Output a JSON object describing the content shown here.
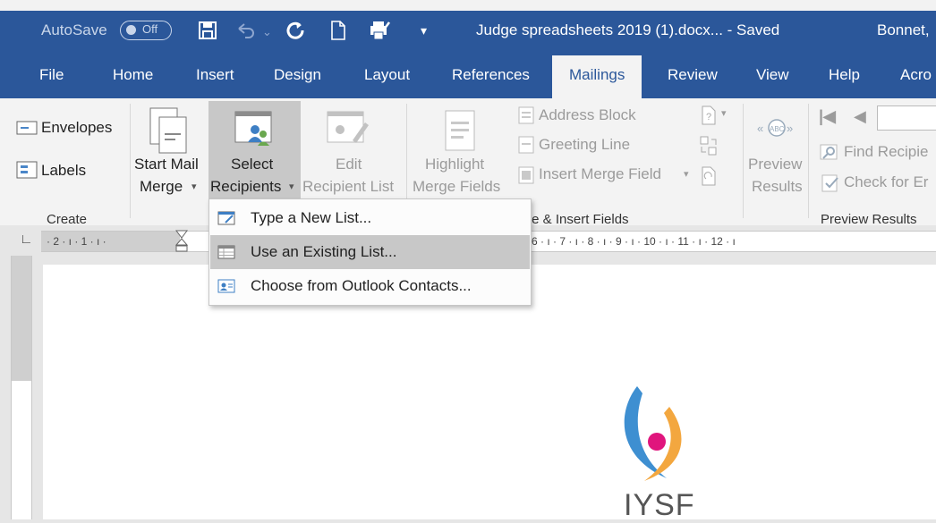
{
  "window": {
    "autosave_label": "AutoSave",
    "autosave_state": "Off",
    "document_title": "Judge spreadsheets 2019 (1).docx...  -  Saved",
    "user_name": "Bonnet,"
  },
  "tabs": [
    "File",
    "Home",
    "Insert",
    "Design",
    "Layout",
    "References",
    "Mailings",
    "Review",
    "View",
    "Help",
    "Acro"
  ],
  "active_tab": "Mailings",
  "ribbon": {
    "create": {
      "envelopes": "Envelopes",
      "labels": "Labels",
      "group": "Create"
    },
    "start_mail_merge": {
      "line1": "Start Mail",
      "line2": "Merge"
    },
    "select_recipients": {
      "line1": "Select",
      "line2": "Recipients"
    },
    "edit_recipient_list": {
      "line1": "Edit",
      "line2": "Recipient List"
    },
    "highlight_merge_fields": {
      "line1": "Highlight",
      "line2": "Merge Fields"
    },
    "address_block": "Address Block",
    "greeting_line": "Greeting Line",
    "insert_merge_field": "Insert Merge Field",
    "write_insert_group": "te & Insert Fields",
    "preview_results_btn": {
      "line1": "Preview",
      "line2": "Results"
    },
    "find_recipient": "Find Recipie",
    "check_for_errors": "Check for Er",
    "preview_group": "Preview Results"
  },
  "menu": {
    "items": [
      {
        "label": "Type a New List...",
        "highlighted": false
      },
      {
        "label": "Use an Existing List...",
        "highlighted": true
      },
      {
        "label": "Choose from Outlook Contacts...",
        "highlighted": false
      }
    ]
  },
  "ruler": {
    "left_numbers": "· 2 · ı · 1 · ı ·",
    "right_numbers": "6 · ı · 7 · ı · 8 · ı · 9 · ı · 10 · ı · 11 · ı · 12 · ı"
  },
  "document": {
    "logo_text": "IYSF"
  },
  "colors": {
    "title_bar": "#2b579a",
    "logo_blue": "#3e8fd1",
    "logo_orange": "#f3a73f",
    "logo_pink": "#e0157d"
  }
}
